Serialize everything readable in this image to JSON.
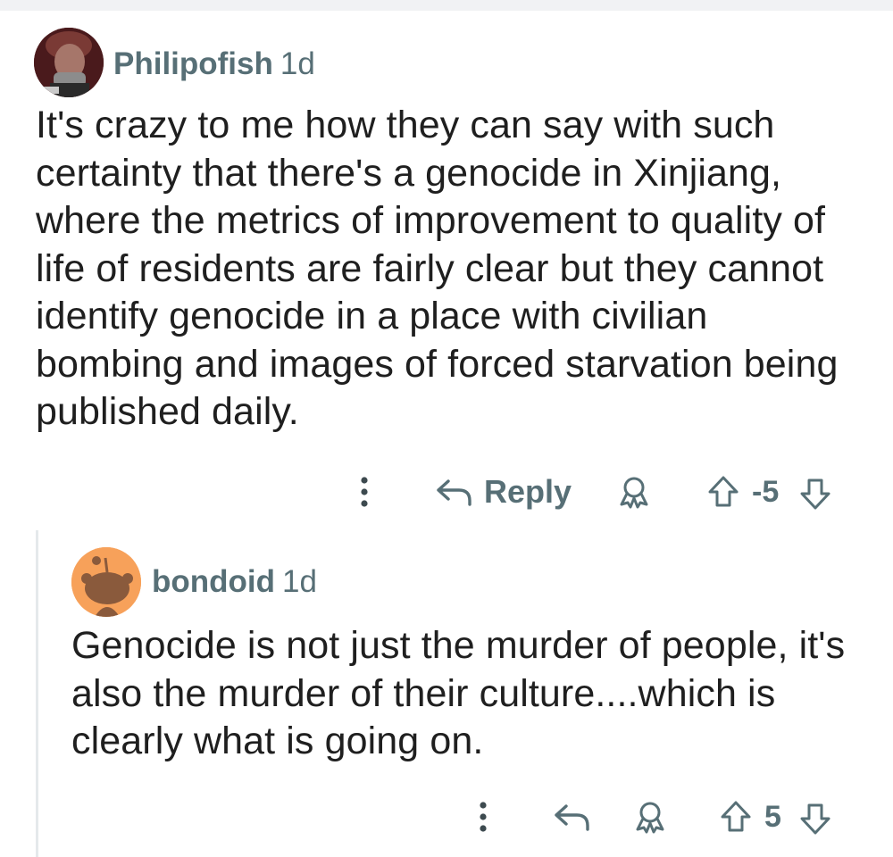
{
  "comments": [
    {
      "username": "Philipofish",
      "age": "1d",
      "text": "It's crazy to me how they can say with such certainty that there's a genocide in Xinjiang, where the metrics of improvement to quality of life of residents are fairly clear but they cannot identify genocide in a place with civilian bombing and images of forced starvation being published daily.",
      "reply_label": "Reply",
      "score": "-5",
      "icons": [
        "more-vertical-icon",
        "reply-arrow-icon",
        "award-icon",
        "upvote-icon",
        "downvote-icon"
      ]
    },
    {
      "username": "bondoid",
      "age": "1d",
      "text": "Genocide is not just the murder of people, it's also the murder of their culture....which is clearly what is going on.",
      "score": "5",
      "icons": [
        "more-vertical-icon",
        "reply-arrow-icon",
        "award-icon",
        "upvote-icon",
        "downvote-icon"
      ]
    }
  ],
  "colors": {
    "meta_gray": "#576f76",
    "text": "#1f1f1f",
    "thread_line": "#e5e9eb",
    "avatar2_bg": "#f7a15a"
  }
}
